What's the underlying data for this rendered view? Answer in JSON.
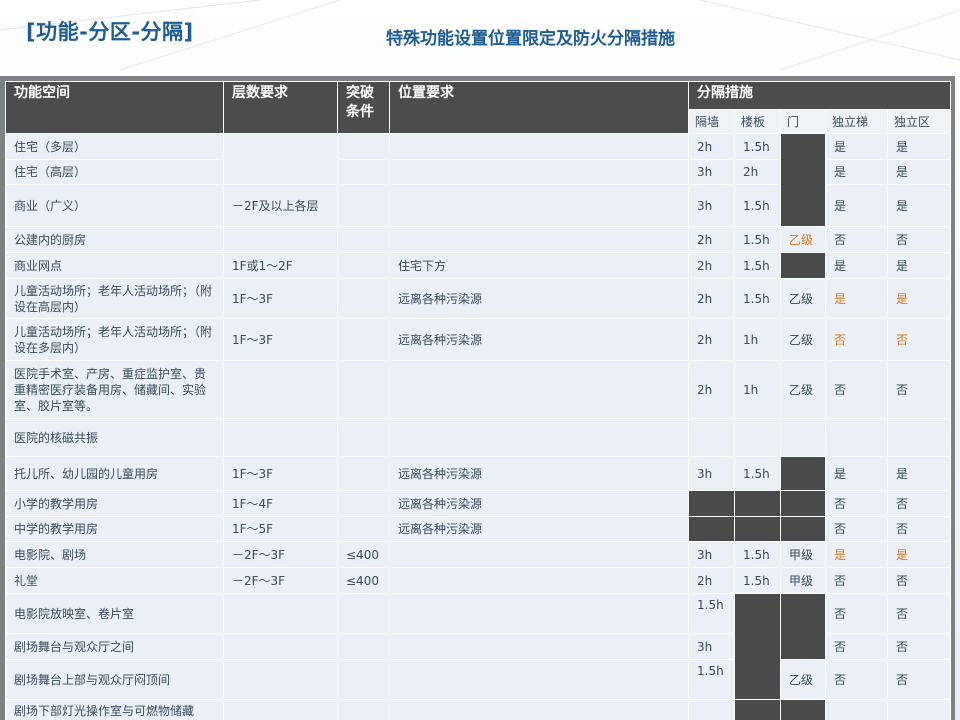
{
  "header": {
    "left_title": "[功能-分区-分隔]",
    "subtitle": "特殊功能设置位置限定及防火分隔措施"
  },
  "table": {
    "headers": {
      "space": "功能空间",
      "floors": "层数要求",
      "breakthrough": "突破条件",
      "location": "位置要求",
      "separation": "分隔措施"
    },
    "subheaders": [
      "隔墙",
      "楼板",
      "门",
      "独立梯",
      "独立区"
    ],
    "rows": [
      {
        "space": "住宅（多层）",
        "wall": "2h",
        "slab": "1.5h",
        "stair": "是",
        "zone": "是"
      },
      {
        "space": "住宅（高层）",
        "wall": "3h",
        "slab": "2h",
        "stair": "是",
        "zone": "是"
      },
      {
        "space": "商业（广义）",
        "floors": "－2F及以上各层",
        "wall": "3h",
        "slab": "1.5h",
        "stair": "是",
        "zone": "是"
      },
      {
        "space": "公建内的厨房",
        "wall": "2h",
        "slab": "1.5h",
        "door": "乙级",
        "stair": "否",
        "zone": "否"
      },
      {
        "space": "商业网点",
        "floors": "1F或1～2F",
        "location": "住宅下方",
        "wall": "2h",
        "slab": "1.5h",
        "stair": "是",
        "zone": "是"
      },
      {
        "space": "儿童活动场所；老年人活动场所；（附设在高层内）",
        "floors": "1F～3F",
        "location": "远离各种污染源",
        "wall": "2h",
        "slab": "1.5h",
        "door": "乙级",
        "stair": "是",
        "zone": "是"
      },
      {
        "space": "儿童活动场所；老年人活动场所；（附设在多层内）",
        "floors": "1F～3F",
        "location": "远离各种污染源",
        "wall": "2h",
        "slab": "1h",
        "door": "乙级",
        "stair": "否",
        "zone": "否"
      },
      {
        "space": "医院手术室、产房、重症监护室、贵重精密医疗装备用房、储藏间、实验室、胶片室等。",
        "wall": "2h",
        "slab": "1h",
        "door": "乙级",
        "stair": "否",
        "zone": "否"
      },
      {
        "space": "医院的核磁共振"
      },
      {
        "space": "托儿所、幼儿园的儿童用房",
        "floors": "1F～3F",
        "location": "远离各种污染源",
        "wall": "3h",
        "slab": "1.5h",
        "stair": "是",
        "zone": "是"
      },
      {
        "space": "小学的教学用房",
        "floors": "1F～4F",
        "location": "远离各种污染源",
        "stair": "否",
        "zone": "否"
      },
      {
        "space": "中学的教学用房",
        "floors": "1F～5F",
        "location": "远离各种污染源",
        "stair": "否",
        "zone": "否"
      },
      {
        "space": "电影院、剧场",
        "floors": "－2F～3F",
        "cond": "≤400",
        "wall": "3h",
        "slab": "1.5h",
        "door": "甲级",
        "stair": "是",
        "zone": "是"
      },
      {
        "space": "礼堂",
        "floors": "－2F～3F",
        "cond": "≤400",
        "wall": "2h",
        "slab": "1.5h",
        "door": "甲级",
        "stair": "否",
        "zone": "否"
      },
      {
        "space": "电影院放映室、卷片室",
        "wall": "1.5h",
        "stair": "否",
        "zone": "否"
      },
      {
        "space": "剧场舞台与观众厅之间",
        "wall": "3h",
        "stair": "否",
        "zone": "否"
      },
      {
        "space": "剧场舞台上部与观众厅闷顶间",
        "wall": "1.5h",
        "door": "乙级",
        "stair": "否",
        "zone": "否"
      },
      {
        "space": "剧场下部灯光操作室与可燃物储藏"
      }
    ]
  },
  "colors": {
    "title_blue": "#1d5d91",
    "header_dark": "#4c4c4c",
    "cell_bg": "#eaf0f5",
    "dark_cell": "#4a4a4a",
    "highlight_orange": "#d5791e",
    "frame_gray": "#7e8183"
  }
}
